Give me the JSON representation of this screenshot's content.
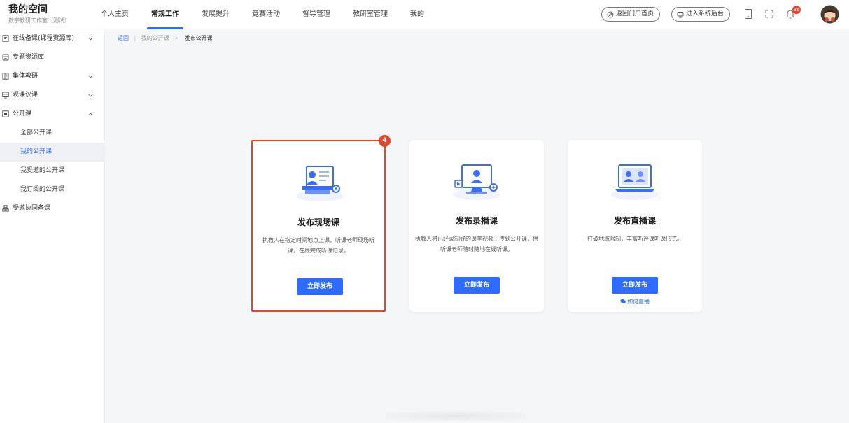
{
  "brand": {
    "title": "我的空间",
    "subtitle": "数字教研工作室（测试）"
  },
  "nav": [
    {
      "label": "个人主页",
      "active": false
    },
    {
      "label": "常规工作",
      "active": true
    },
    {
      "label": "发展提升",
      "active": false
    },
    {
      "label": "竞赛活动",
      "active": false
    },
    {
      "label": "督导管理",
      "active": false
    },
    {
      "label": "教研室管理",
      "active": false
    },
    {
      "label": "我的",
      "active": false
    }
  ],
  "header": {
    "portal_btn": "返回门户首页",
    "admin_btn": "进入系统后台",
    "notify_count": "36",
    "icons": [
      "mobile-icon",
      "fullscreen-icon",
      "bell-icon",
      "avatar"
    ]
  },
  "sidebar": {
    "items": [
      {
        "label": "在线备课(课程资源库)",
        "icon": "document-icon"
      },
      {
        "label": "专题资源库",
        "icon": "folder-icon"
      },
      {
        "label": "集体教研",
        "icon": "list-icon"
      },
      {
        "label": "观课议课",
        "icon": "review-icon"
      },
      {
        "label": "公开课",
        "icon": "screen-icon"
      },
      {
        "label": "受邀协同备课",
        "icon": "team-icon"
      }
    ],
    "sub": [
      "全部公开课",
      "我的公开课",
      "我受邀的公开课",
      "我订阅的公开课"
    ]
  },
  "breadcrumb": {
    "back": "返回",
    "parent": "我的公开课",
    "current": "发布公开课"
  },
  "cards": [
    {
      "title": "发布现场课",
      "desc": "执教人在指定时间地点上课，听课老师现场听课，在线完成听课记录。",
      "button": "立即发布",
      "badge": "4"
    },
    {
      "title": "发布录播课",
      "desc": "执教人将已经录制好的课堂视频上传到公开课，供听课老师随时随地在线听课。",
      "button": "立即发布"
    },
    {
      "title": "发布直播课",
      "desc": "打破地域限制，丰富听评课听课形式。",
      "button": "立即发布",
      "link": "如何直播"
    }
  ],
  "colors": {
    "accent": "#2f6bff",
    "highlight": "#d94a2e"
  }
}
